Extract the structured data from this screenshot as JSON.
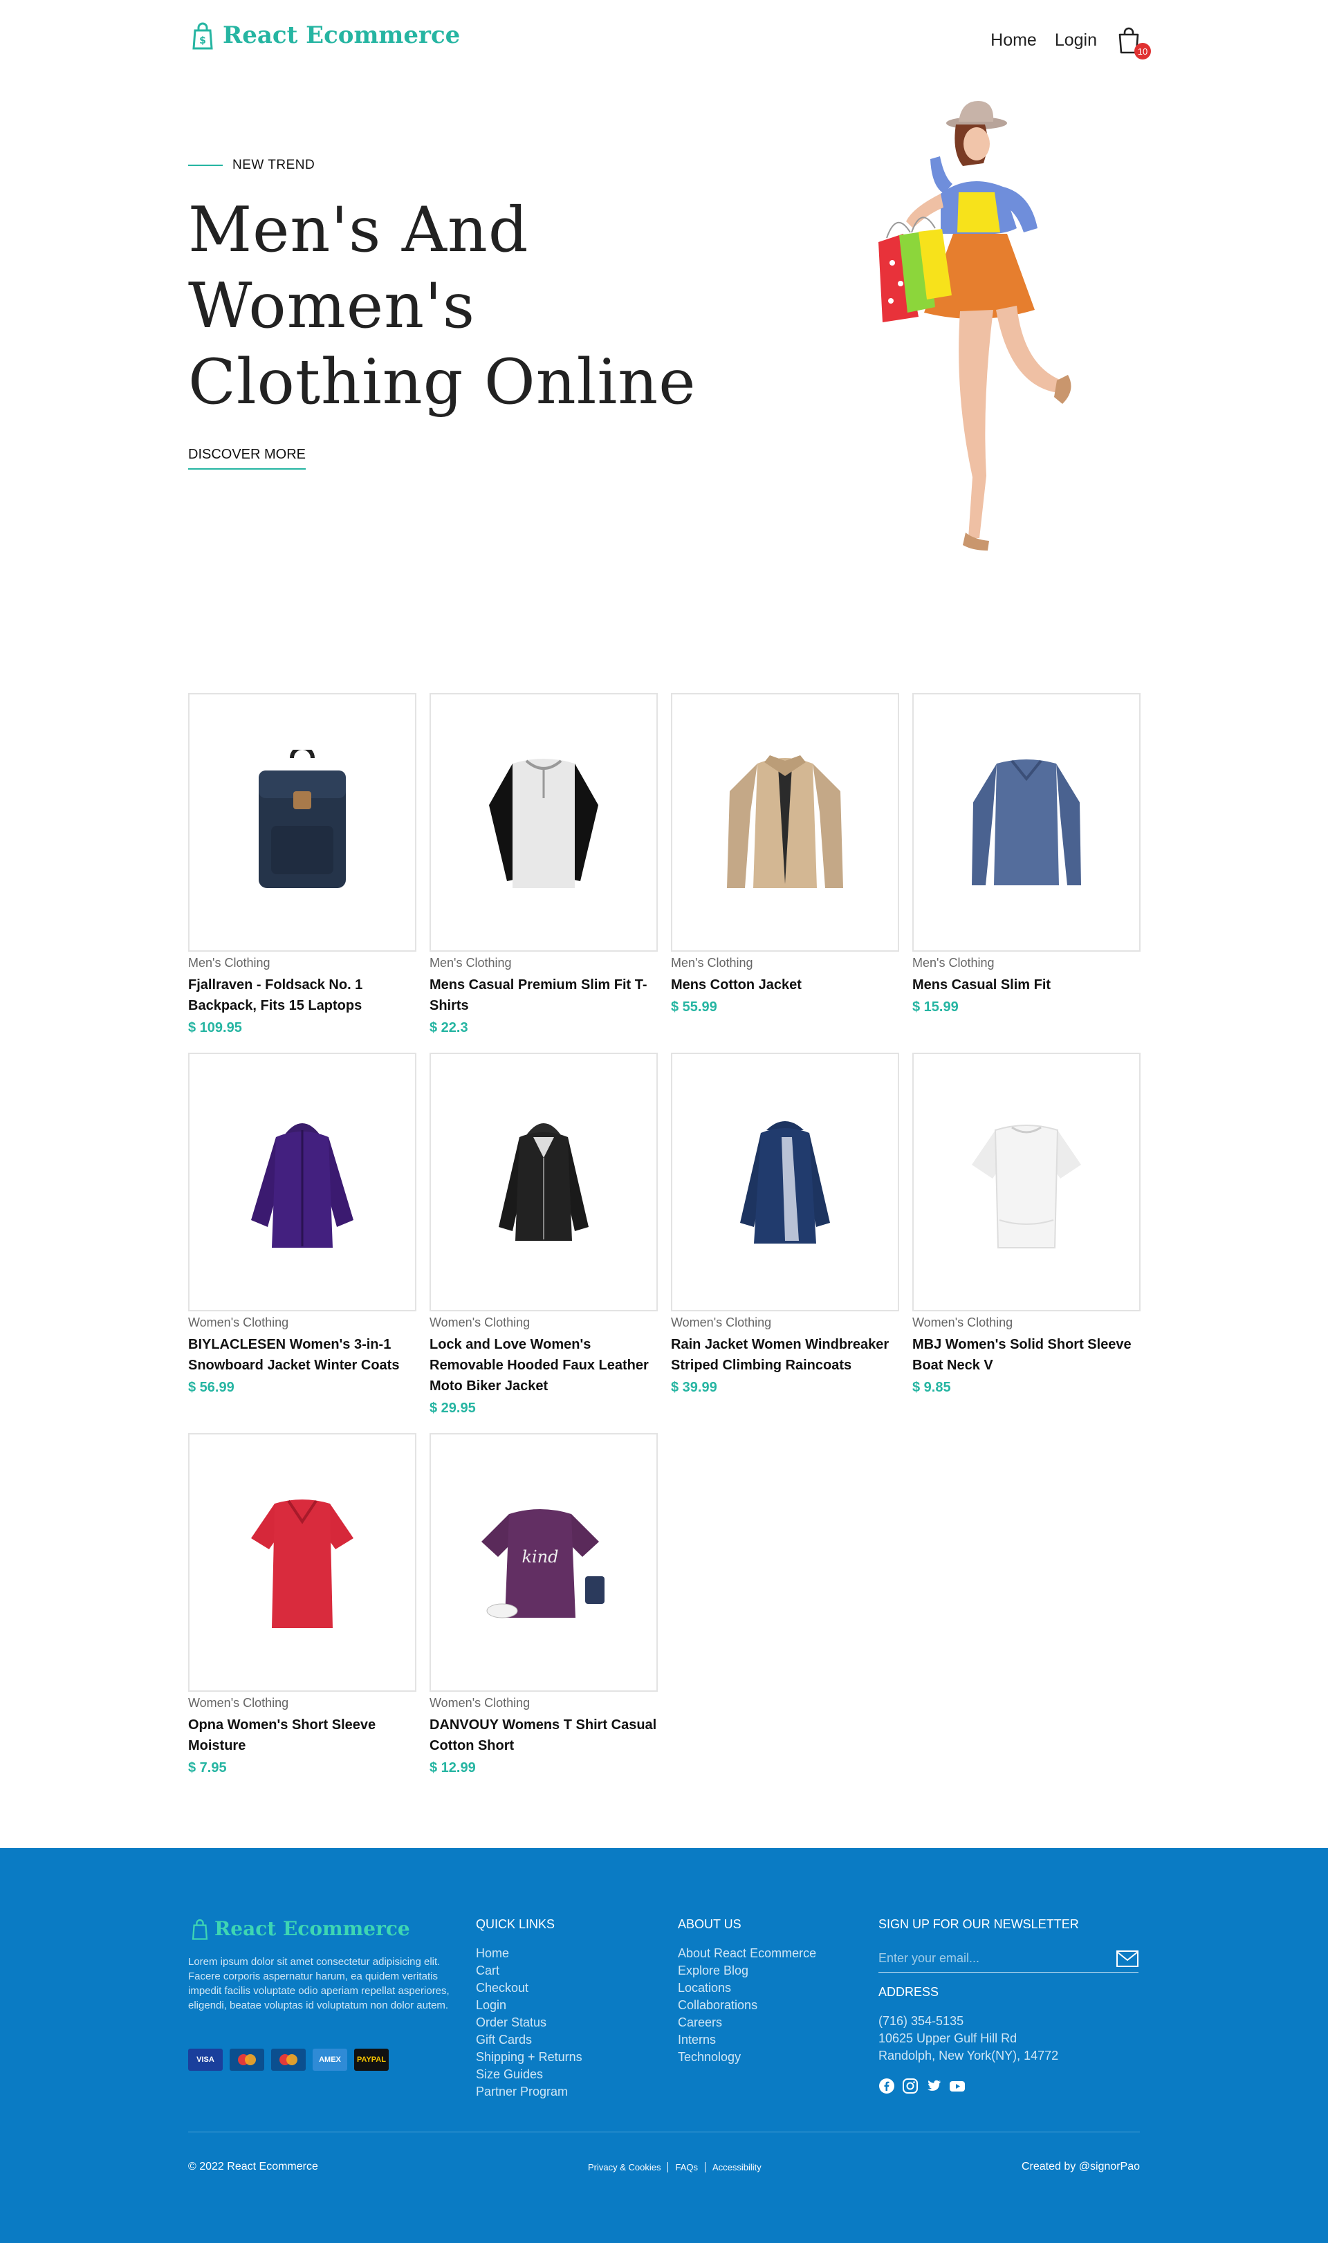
{
  "brand": {
    "name": "React Ecommerce",
    "color": "#26b5a2"
  },
  "nav": {
    "home": "Home",
    "login": "Login",
    "cart_count": "10"
  },
  "hero": {
    "tag": "NEW TREND",
    "title": "Men's And Women's Clothing Online",
    "cta": "DISCOVER MORE"
  },
  "products": [
    {
      "category": "Men's Clothing",
      "name": "Fjallraven - Foldsack No. 1 Backpack, Fits 15 Laptops",
      "price": "$ 109.95",
      "icon": "backpack"
    },
    {
      "category": "Men's Clothing",
      "name": "Mens Casual Premium Slim Fit T-Shirts",
      "price": "$ 22.3",
      "icon": "raglan-tshirt"
    },
    {
      "category": "Men's Clothing",
      "name": "Mens Cotton Jacket",
      "price": "$ 55.99",
      "icon": "cotton-jacket"
    },
    {
      "category": "Men's Clothing",
      "name": "Mens Casual Slim Fit",
      "price": "$ 15.99",
      "icon": "longsleeve-shirt"
    },
    {
      "category": "Women's Clothing",
      "name": "BIYLACLESEN Women's 3-in-1 Snowboard Jacket Winter Coats",
      "price": "$ 56.99",
      "icon": "snow-jacket"
    },
    {
      "category": "Women's Clothing",
      "name": "Lock and Love Women's Removable Hooded Faux Leather Moto Biker Jacket",
      "price": "$ 29.95",
      "icon": "leather-jacket"
    },
    {
      "category": "Women's Clothing",
      "name": "Rain Jacket Women Windbreaker Striped Climbing Raincoats",
      "price": "$ 39.99",
      "icon": "rain-jacket"
    },
    {
      "category": "Women's Clothing",
      "name": "MBJ Women's Solid Short Sleeve Boat Neck V",
      "price": "$ 9.85",
      "icon": "white-top"
    },
    {
      "category": "Women's Clothing",
      "name": "Opna Women's Short Sleeve Moisture",
      "price": "$ 7.95",
      "icon": "red-tshirt"
    },
    {
      "category": "Women's Clothing",
      "name": "DANVOUY Womens T Shirt Casual Cotton Short",
      "price": "$ 12.99",
      "icon": "purple-tshirt"
    }
  ],
  "footer": {
    "about": "Lorem ipsum dolor sit amet consectetur adipisicing elit. Facere corporis aspernatur harum, ea quidem veritatis impedit facilis voluptate odio aperiam repellat asperiores, eligendi, beatae voluptas id voluptatum non dolor autem.",
    "payment_cards": [
      "VISA",
      "maestro",
      "mastercard",
      "AMEX",
      "PAYPAL"
    ],
    "quick_links": {
      "title": "QUICK LINKS",
      "items": [
        "Home",
        "Cart",
        "Checkout",
        "Login",
        "Order Status",
        "Gift Cards",
        "Shipping + Returns",
        "Size Guides",
        "Partner Program"
      ]
    },
    "about_us": {
      "title": "ABOUT US",
      "items": [
        "About React Ecommerce",
        "Explore Blog",
        "Locations",
        "Collaborations",
        "Careers",
        "Interns",
        "Technology"
      ]
    },
    "newsletter": {
      "title": "SIGN UP FOR OUR NEWSLETTER",
      "placeholder": "Enter your email..."
    },
    "address": {
      "title": "ADDRESS",
      "lines": [
        "(716) 354-5135",
        "10625 Upper Gulf Hill Rd",
        "Randolph, New York(NY), 14772"
      ]
    },
    "social": [
      "facebook-icon",
      "instagram-icon",
      "twitter-icon",
      "youtube-icon"
    ],
    "copyright": "© 2022 React Ecommerce",
    "legal": [
      "Privacy & Cookies",
      "FAQs",
      "Accessibility"
    ],
    "credit": "Created by @signorPao"
  }
}
